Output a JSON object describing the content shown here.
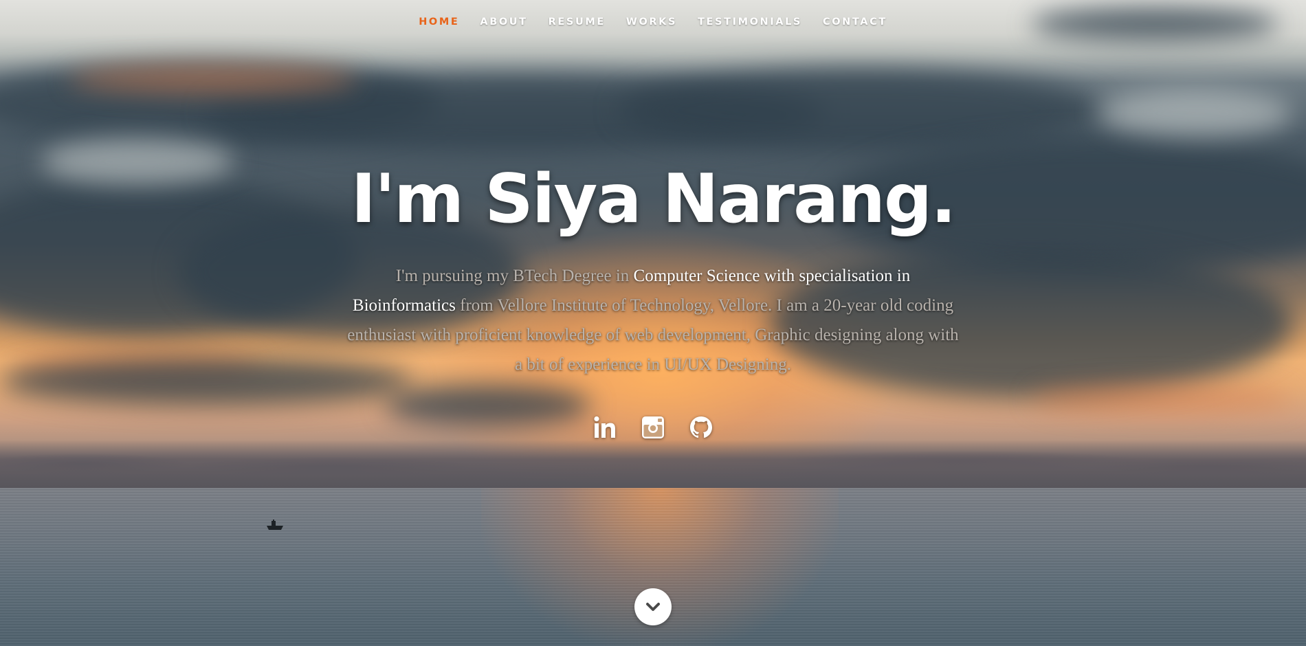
{
  "nav": {
    "items": [
      {
        "label": "HOME",
        "active": true
      },
      {
        "label": "ABOUT",
        "active": false
      },
      {
        "label": "RESUME",
        "active": false
      },
      {
        "label": "WORKS",
        "active": false
      },
      {
        "label": "TESTIMONIALS",
        "active": false
      },
      {
        "label": "CONTACT",
        "active": false
      }
    ],
    "active_color": "#e8641a"
  },
  "hero": {
    "title": "I'm Siya Narang.",
    "description": {
      "part1": "I'm pursuing my BTech Degree in ",
      "highlight1": "Computer Science with specialisation in Bioinformatics",
      "part2": " from Vellore Institute of Technology, Vellore. I am a 20-year old coding enthusiast with proficient knowledge of web development, Graphic designing along with a bit of experience in UI/UX Designing."
    }
  },
  "socials": [
    {
      "icon": "linkedin-icon"
    },
    {
      "icon": "instagram-icon"
    },
    {
      "icon": "github-icon"
    }
  ],
  "scroll_button": {
    "icon": "chevron-down-icon"
  },
  "background": {
    "subject": "sunset-over-sea"
  }
}
